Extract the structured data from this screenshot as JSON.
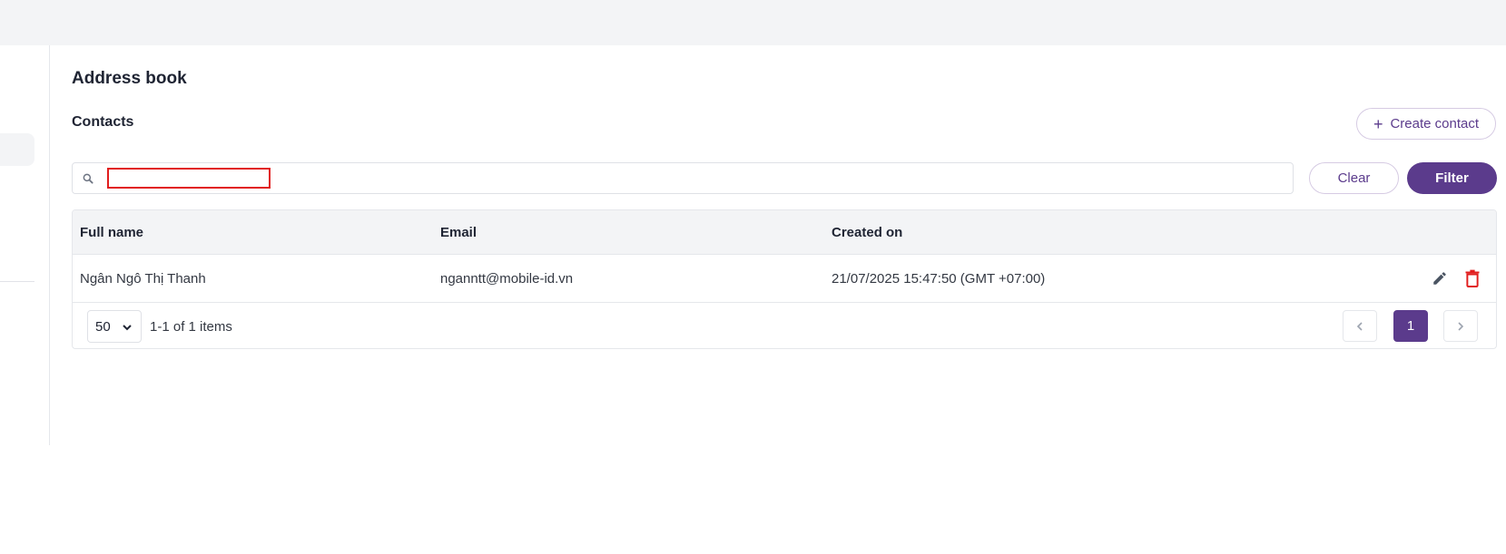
{
  "page": {
    "title": "Address book"
  },
  "contacts": {
    "section_title": "Contacts",
    "create_label": "Create contact",
    "search": {
      "value": "",
      "placeholder": ""
    },
    "clear_label": "Clear",
    "filter_label": "Filter",
    "table": {
      "headers": [
        "Full name",
        "Email",
        "Created on"
      ],
      "rows": [
        {
          "full_name": "Ngân Ngô Thị Thanh",
          "email": "nganntt@mobile-id.vn",
          "created_on": "21/07/2025 15:47:50 (GMT +07:00)"
        }
      ]
    },
    "pagination": {
      "page_size": "50",
      "items_info": "1-1 of 1 items",
      "current_page": "1"
    }
  },
  "colors": {
    "brand": "#5b3b8c",
    "danger": "#e11d1d",
    "header_bg": "#f3f4f6"
  },
  "icons": [
    "search-icon",
    "plus-icon",
    "edit-icon",
    "delete-icon",
    "chevron-down-icon",
    "chevron-left-icon",
    "chevron-right-icon"
  ]
}
